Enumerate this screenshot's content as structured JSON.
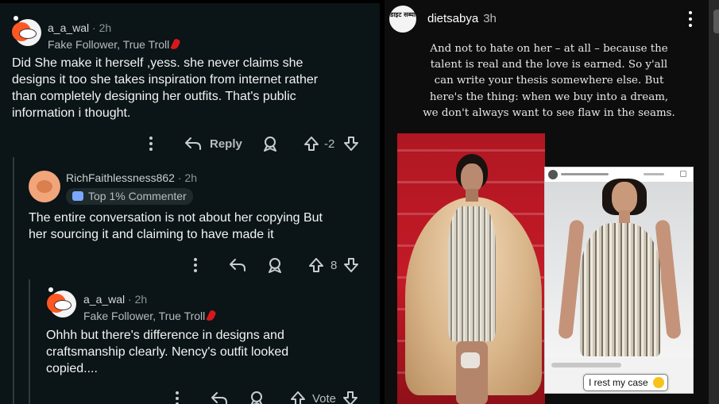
{
  "reddit": {
    "comments": [
      {
        "username": "a_a_wal",
        "time": "2h",
        "flair": "Fake Follower, True Troll",
        "body": [
          "Did She make it herself ,yess. she never claims she",
          "designs it too she takes inspiration from internet rather",
          "than completely designing her outfits. That's public",
          "information i thought."
        ],
        "reply_label": "Reply",
        "vote_count": "-2"
      },
      {
        "username": "RichFaithlessness862",
        "time": "2h",
        "badge": "Top 1% Commenter",
        "body": [
          "The entire conversation is not about her copying But",
          "her sourcing it and claiming to have made it"
        ],
        "vote_count": "8"
      },
      {
        "username": "a_a_wal",
        "time": "2h",
        "flair": "Fake Follower, True Troll",
        "body": [
          "Ohhh but there's difference in designs and",
          "craftsmanship clearly. Nency's outfit looked",
          "copied...."
        ],
        "vote_count": "Vote"
      }
    ]
  },
  "story": {
    "logo_text": "डाइट सब्या",
    "username": "dietsabya",
    "time": "3h",
    "caption_lines": [
      "And not to hate on her – at all – because the",
      "talent is real and the love is earned. So y'all",
      "can write your thesis somewhere else. But",
      "here's the thing: when we buy into a dream,",
      "we don't always want to see flaw in the seams."
    ],
    "sticker_text": "I rest my case"
  },
  "colors": {
    "reddit_bg": "#0b1416",
    "story_bg": "#0d0d0d",
    "carpet_red": "#c41a27",
    "chili": "#d6181d"
  }
}
